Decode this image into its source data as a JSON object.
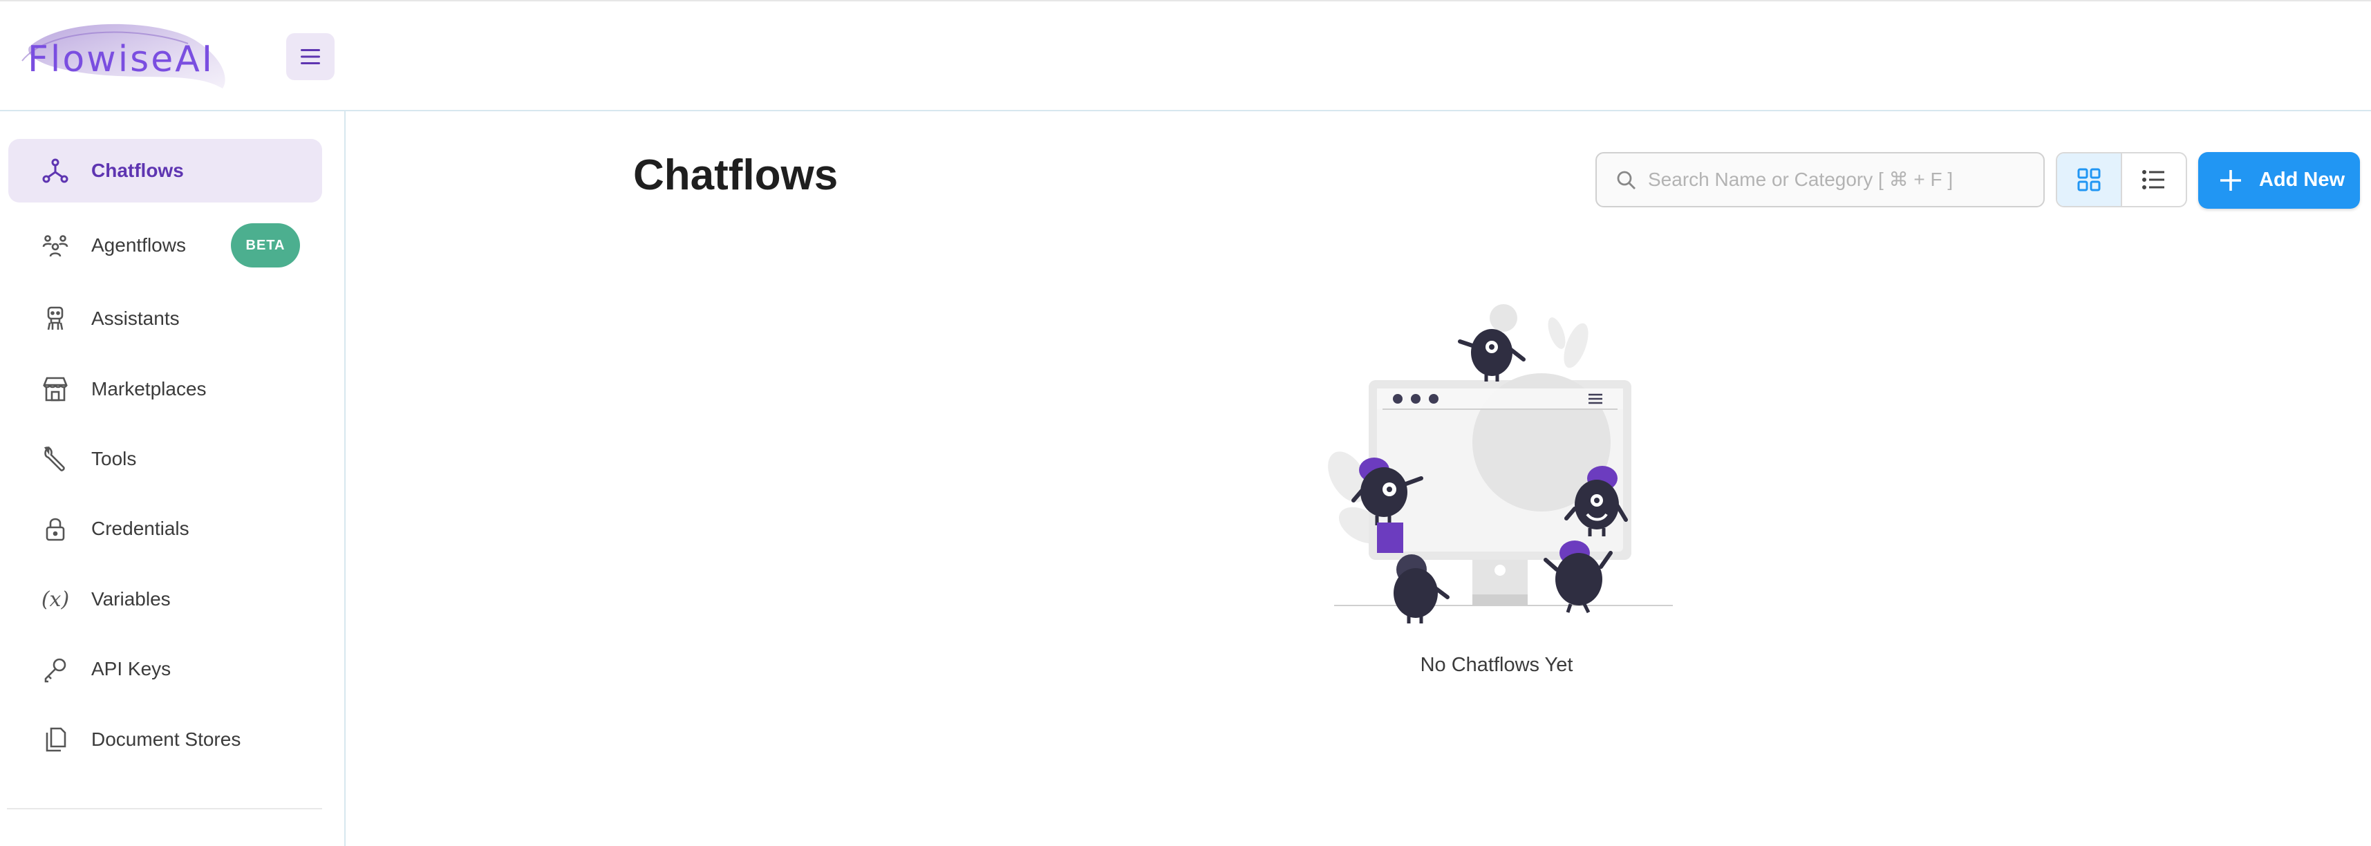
{
  "app": {
    "logo_text": "FlowiseAI"
  },
  "sidebar": {
    "items": [
      {
        "label": "Chatflows",
        "icon": "hierarchy-icon",
        "active": true
      },
      {
        "label": "Agentflows",
        "icon": "users-group-icon",
        "badge": "BETA"
      },
      {
        "label": "Assistants",
        "icon": "robot-icon"
      },
      {
        "label": "Marketplaces",
        "icon": "storefront-icon"
      },
      {
        "label": "Tools",
        "icon": "wrench-icon"
      },
      {
        "label": "Credentials",
        "icon": "lock-icon"
      },
      {
        "label": "Variables",
        "icon": "variable-icon",
        "glyph": "(x)"
      },
      {
        "label": "API Keys",
        "icon": "key-icon"
      },
      {
        "label": "Document Stores",
        "icon": "files-icon"
      }
    ]
  },
  "main": {
    "title": "Chatflows",
    "search_placeholder": "Search Name or Category [ ⌘ + F ]",
    "view_toggle": {
      "selected": "grid"
    },
    "add_button_label": "Add New",
    "empty_state_text": "No Chatflows Yet"
  },
  "colors": {
    "accent_purple": "#5e35b1",
    "active_bg": "#ede7f6",
    "primary_blue": "#2196f3",
    "beta_green": "#4caf8f"
  }
}
